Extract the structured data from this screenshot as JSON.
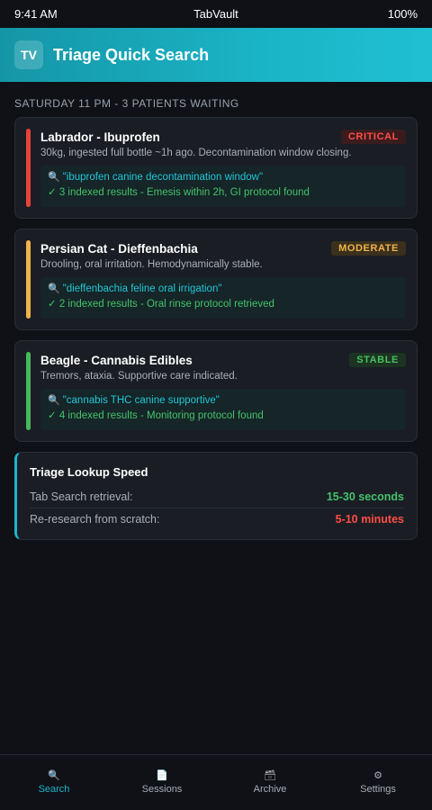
{
  "status_bar": {
    "time": "9:41 AM",
    "title": "TabVault",
    "battery": "100%"
  },
  "header": {
    "logo": "TV",
    "title": "Triage Quick Search"
  },
  "section_label": "SATURDAY 11 PM - 3 PATIENTS WAITING",
  "patients": [
    {
      "title": "Labrador - Ibuprofen",
      "badge": "CRITICAL",
      "desc": "30kg, ingested full bottle ~1h ago. Decontamination window closing.",
      "query": "\"ibuprofen canine decontamination window\"",
      "result": "✓ 3 indexed results - Emesis within 2h, GI protocol found",
      "stripe_color": "#e8433a",
      "badge_color": "#ff4d45",
      "badge_bg": "#3a1c1f"
    },
    {
      "title": "Persian Cat - Dieffenbachia",
      "badge": "MODERATE",
      "desc": "Drooling, oral irritation. Hemodynamically stable.",
      "query": "\"dieffenbachia feline oral irrigation\"",
      "result": "✓ 2 indexed results - Oral rinse protocol retrieved",
      "stripe_color": "#f0b34a",
      "badge_color": "#f0b34a",
      "badge_bg": "#3a301c"
    },
    {
      "title": "Beagle - Cannabis Edibles",
      "badge": "STABLE",
      "desc": "Tremors, ataxia. Supportive care indicated.",
      "query": "\"cannabis THC canine supportive\"",
      "result": "✓ 4 indexed results - Monitoring protocol found",
      "stripe_color": "#46b85a",
      "badge_color": "#46c060",
      "badge_bg": "#1c3322"
    }
  ],
  "speed": {
    "title": "Triage Lookup Speed",
    "rows": [
      {
        "label": "Tab Search retrieval:",
        "value": "15-30 seconds",
        "color": "#45c26a"
      },
      {
        "label": "Re-research from scratch:",
        "value": "5-10 minutes",
        "color": "#ff4d45"
      }
    ]
  },
  "nav": [
    {
      "label": "Search",
      "icon": "search-icon",
      "glyph": "🔍",
      "active": true
    },
    {
      "label": "Sessions",
      "icon": "document-icon",
      "glyph": "📄",
      "active": false
    },
    {
      "label": "Archive",
      "icon": "archive-icon",
      "glyph": "🗃",
      "active": false
    },
    {
      "label": "Settings",
      "icon": "gear-icon",
      "glyph": "⚙",
      "active": false
    }
  ],
  "colors": {
    "accent": "#1cb6c8",
    "background": "#0f1117",
    "card": "#1a1d24"
  }
}
